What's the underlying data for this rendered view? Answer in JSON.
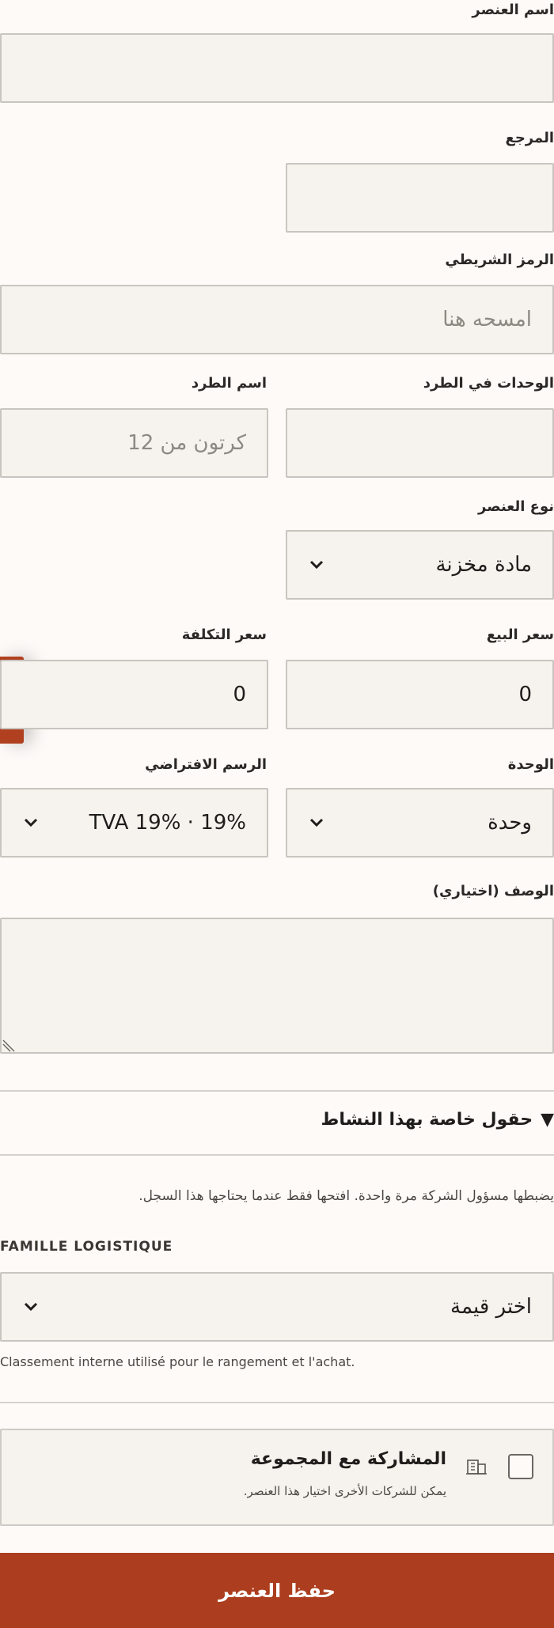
{
  "form": {
    "item_name": {
      "label": "اسم العنصر",
      "value": ""
    },
    "reference": {
      "label": "المرجع",
      "value": ""
    },
    "barcode": {
      "label": "الرمز الشريطي",
      "placeholder": "امسحه هنا"
    },
    "units_per_package": {
      "label": "الوحدات في الطرد",
      "value": ""
    },
    "package_name": {
      "label": "اسم الطرد",
      "placeholder": "كرتون من 12"
    },
    "item_type": {
      "label": "نوع العنصر",
      "selected": "مادة مخزنة"
    },
    "sale_price": {
      "label": "سعر البيع",
      "value": "0"
    },
    "cost_price": {
      "label": "سعر التكلفة",
      "value": "0"
    },
    "unit": {
      "label": "الوحدة",
      "selected": "وحدة"
    },
    "default_tax": {
      "label": "الرسم الافتراضي",
      "selected": "TVA 19% · 19%"
    },
    "description": {
      "label": "الوصف (اختياري)",
      "value": ""
    }
  },
  "activity_section": {
    "toggle_icon": "▼",
    "title": "حقول خاصة بهذا النشاط",
    "help": "يضبطها مسؤول الشركة مرة واحدة. افتحها فقط عندما يحتاجها هذا السجل.",
    "famille": {
      "label": "FAMILLE LOGISTIQUE",
      "selected": "اختر قيمة",
      "hint": "Classement interne utilisé pour le rangement et l'achat."
    }
  },
  "share": {
    "title": "المشاركة مع المجموعة",
    "subtitle": "يمكن للشركات الأخرى اختيار هذا العنصر.",
    "icon": "building-icon",
    "checked": false
  },
  "actions": {
    "save_label": "حفظ العنصر"
  },
  "colors": {
    "accent": "#ac3e1f",
    "field_bg": "#f6f3ee",
    "page_bg": "#fdfaf8",
    "border": "#c9c4be"
  }
}
